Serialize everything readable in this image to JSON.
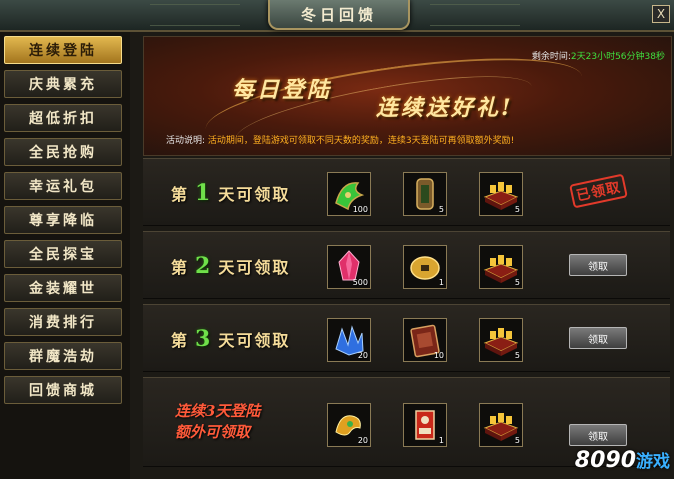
{
  "window": {
    "title": "冬日回馈",
    "close_label": "X"
  },
  "sidebar": {
    "items": [
      {
        "label": "连续登陆",
        "active": true
      },
      {
        "label": "庆典累充"
      },
      {
        "label": "超低折扣"
      },
      {
        "label": "全民抢购"
      },
      {
        "label": "幸运礼包"
      },
      {
        "label": "尊享降临"
      },
      {
        "label": "全民探宝"
      },
      {
        "label": "金装耀世"
      },
      {
        "label": "消费排行"
      },
      {
        "label": "群魔浩劫"
      },
      {
        "label": "回馈商城"
      }
    ]
  },
  "banner": {
    "title_part1": "每日登陆",
    "title_part2": "连续送好礼!",
    "countdown_label": "剩余时间:",
    "countdown_value": "2天23小时56分钟38秒",
    "desc_label": "活动说明:",
    "desc_text": "活动期间，登陆游戏可领取不同天数的奖励，连续3天登陆可再领取额外奖励!"
  },
  "rows": [
    {
      "prefix": "第",
      "day": "1",
      "suffix": "天可领取",
      "items": [
        {
          "icon": "green-jade-artifact-icon",
          "count": "100"
        },
        {
          "icon": "bronze-token-icon",
          "count": "5"
        },
        {
          "icon": "gold-ingot-chest-icon",
          "count": "5"
        }
      ],
      "status": "claimed",
      "stamp_text": "已领取"
    },
    {
      "prefix": "第",
      "day": "2",
      "suffix": "天可领取",
      "items": [
        {
          "icon": "pink-crystal-icon",
          "count": "500"
        },
        {
          "icon": "gold-coin-icon",
          "count": "1"
        },
        {
          "icon": "gold-ingot-chest-icon",
          "count": "5"
        }
      ],
      "status": "available",
      "button_label": "领取"
    },
    {
      "prefix": "第",
      "day": "3",
      "suffix": "天可领取",
      "items": [
        {
          "icon": "blue-crystal-icon",
          "count": "20"
        },
        {
          "icon": "red-manual-icon",
          "count": "10"
        },
        {
          "icon": "gold-ingot-chest-icon",
          "count": "5"
        }
      ],
      "status": "available",
      "button_label": "领取"
    }
  ],
  "bonus_row": {
    "label_line1": "连续3天登陆",
    "label_line2": "额外可领取",
    "items": [
      {
        "icon": "golden-relic-icon",
        "count": "20"
      },
      {
        "icon": "red-scroll-icon",
        "count": "1"
      },
      {
        "icon": "gold-ingot-chest-icon",
        "count": "5"
      }
    ],
    "button_label": "领取"
  },
  "watermark": {
    "brand": "8090",
    "cn": "游戏"
  }
}
